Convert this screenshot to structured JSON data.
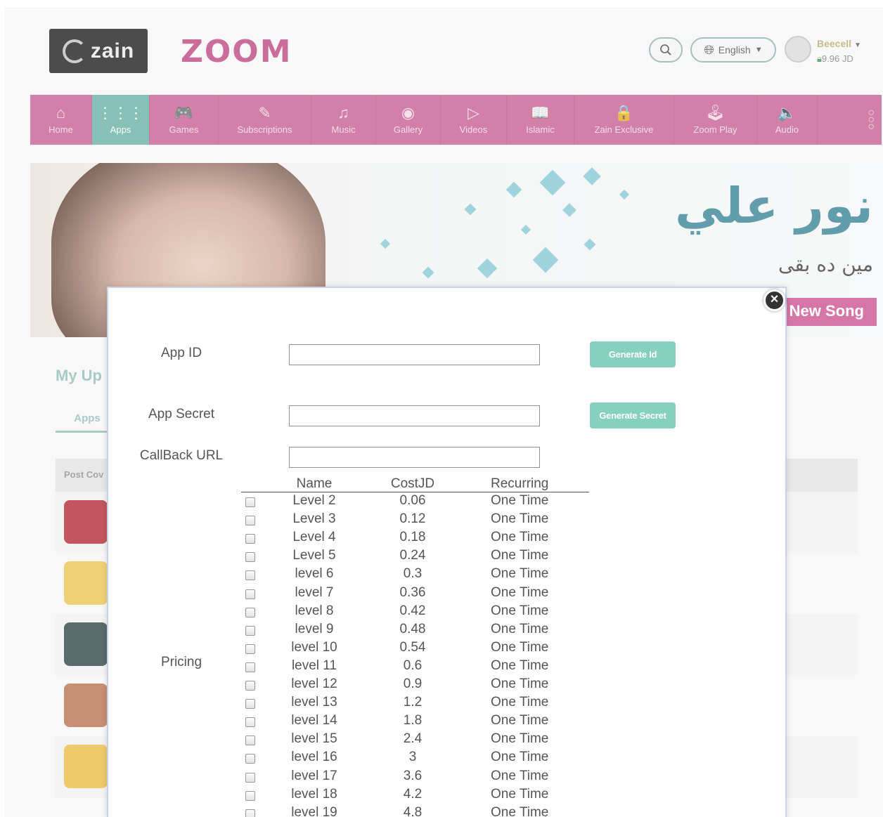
{
  "header": {
    "zain_logo_text": "zain",
    "zoom_logo_text": "ZOOM",
    "language": "English",
    "user_name": "Beecell",
    "balance": "9.96 JD"
  },
  "nav": {
    "items": [
      {
        "label": "Home",
        "icon": "home-icon",
        "glyph": "⌂"
      },
      {
        "label": "Apps",
        "icon": "apps-grid-icon",
        "glyph": "⋮⋮⋮"
      },
      {
        "label": "Games",
        "icon": "gamepad-icon",
        "glyph": "🎮"
      },
      {
        "label": "Subscriptions",
        "icon": "edit-icon",
        "glyph": "✎"
      },
      {
        "label": "Music",
        "icon": "music-note-icon",
        "glyph": "♫"
      },
      {
        "label": "Gallery",
        "icon": "gallery-icon",
        "glyph": "◉"
      },
      {
        "label": "Videos",
        "icon": "play-icon",
        "glyph": "▷"
      },
      {
        "label": "Islamic",
        "icon": "book-icon",
        "glyph": "📖"
      },
      {
        "label": "Zain Exclusive",
        "icon": "lock-icon",
        "glyph": "🔒"
      },
      {
        "label": "Zoom Play",
        "icon": "controller-icon",
        "glyph": "🕹"
      },
      {
        "label": "Audio",
        "icon": "speaker-icon",
        "glyph": "🔈"
      }
    ],
    "active": "Apps"
  },
  "banner": {
    "title_ar": "نور علي",
    "subtitle_ar": "مين ده بقى",
    "badge": "New Song"
  },
  "uploads": {
    "title": "My Up",
    "tab": "Apps",
    "column_header": "Post Cov"
  },
  "modal": {
    "app_id_label": "App ID",
    "app_id_value": "",
    "generate_id_label": "Generate Id",
    "app_secret_label": "App Secret",
    "app_secret_value": "",
    "generate_secret_label": "Generate Secret",
    "callback_label": "CallBack URL",
    "callback_value": "",
    "pricing_label": "Pricing",
    "close_icon": "close-icon",
    "pricing": {
      "headers": [
        "Name",
        "CostJD",
        "Recurring"
      ],
      "rows": [
        {
          "name": "Level 2",
          "cost": "0.06",
          "recurring": "One Time",
          "checked": false
        },
        {
          "name": "Level 3",
          "cost": "0.12",
          "recurring": "One Time",
          "checked": false
        },
        {
          "name": "Level 4",
          "cost": "0.18",
          "recurring": "One Time",
          "checked": false
        },
        {
          "name": "Level 5",
          "cost": "0.24",
          "recurring": "One Time",
          "checked": false
        },
        {
          "name": "level 6",
          "cost": "0.3",
          "recurring": "One Time",
          "checked": false
        },
        {
          "name": "level 7",
          "cost": "0.36",
          "recurring": "One Time",
          "checked": false
        },
        {
          "name": "level 8",
          "cost": "0.42",
          "recurring": "One Time",
          "checked": false
        },
        {
          "name": "level 9",
          "cost": "0.48",
          "recurring": "One Time",
          "checked": false
        },
        {
          "name": "level 10",
          "cost": "0.54",
          "recurring": "One Time",
          "checked": false
        },
        {
          "name": "level 11",
          "cost": "0.6",
          "recurring": "One Time",
          "checked": false
        },
        {
          "name": "level 12",
          "cost": "0.9",
          "recurring": "One Time",
          "checked": false
        },
        {
          "name": "level 13",
          "cost": "1.2",
          "recurring": "One Time",
          "checked": false
        },
        {
          "name": "level 14",
          "cost": "1.8",
          "recurring": "One Time",
          "checked": false
        },
        {
          "name": "level 15",
          "cost": "2.4",
          "recurring": "One Time",
          "checked": false
        },
        {
          "name": "level 16",
          "cost": "3",
          "recurring": "One Time",
          "checked": false
        },
        {
          "name": "level 17",
          "cost": "3.6",
          "recurring": "One Time",
          "checked": false
        },
        {
          "name": "level 18",
          "cost": "4.2",
          "recurring": "One Time",
          "checked": false
        },
        {
          "name": "level 19",
          "cost": "4.8",
          "recurring": "One Time",
          "checked": false
        }
      ]
    }
  },
  "colors": {
    "nav_bg": "#c3558c",
    "nav_active": "#5eab9e",
    "button_teal": "#86d0c0",
    "banner_badge": "#c9498b"
  }
}
